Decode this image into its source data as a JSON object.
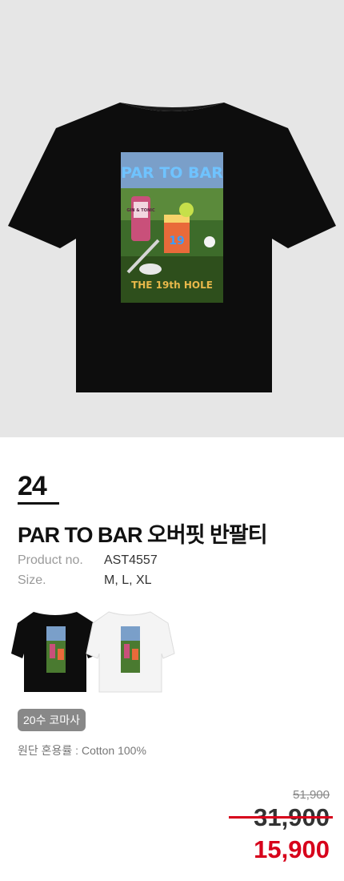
{
  "product": {
    "number": "24",
    "title": "PAR TO BAR 오버핏 반팔티",
    "specs": [
      {
        "label": "Product no.",
        "value": "AST4557"
      },
      {
        "label": "Size.",
        "value": "M, L, XL"
      }
    ],
    "badge": "20수 코마사",
    "fabric": "원단 혼용률 : Cotton 100%",
    "artwork_text": {
      "headline": "PAR TO BAR",
      "bottle": "GIN & TONIC",
      "glass": "19",
      "footer": "THE 19th HOLE"
    },
    "colors_shown": [
      "black",
      "white"
    ]
  },
  "price": {
    "original": "51,900",
    "sale": "31,900",
    "final": "15,900"
  },
  "colors": {
    "accent": "#d7001b",
    "hero_bg": "#e6e6e6",
    "badge_bg": "#888888"
  }
}
